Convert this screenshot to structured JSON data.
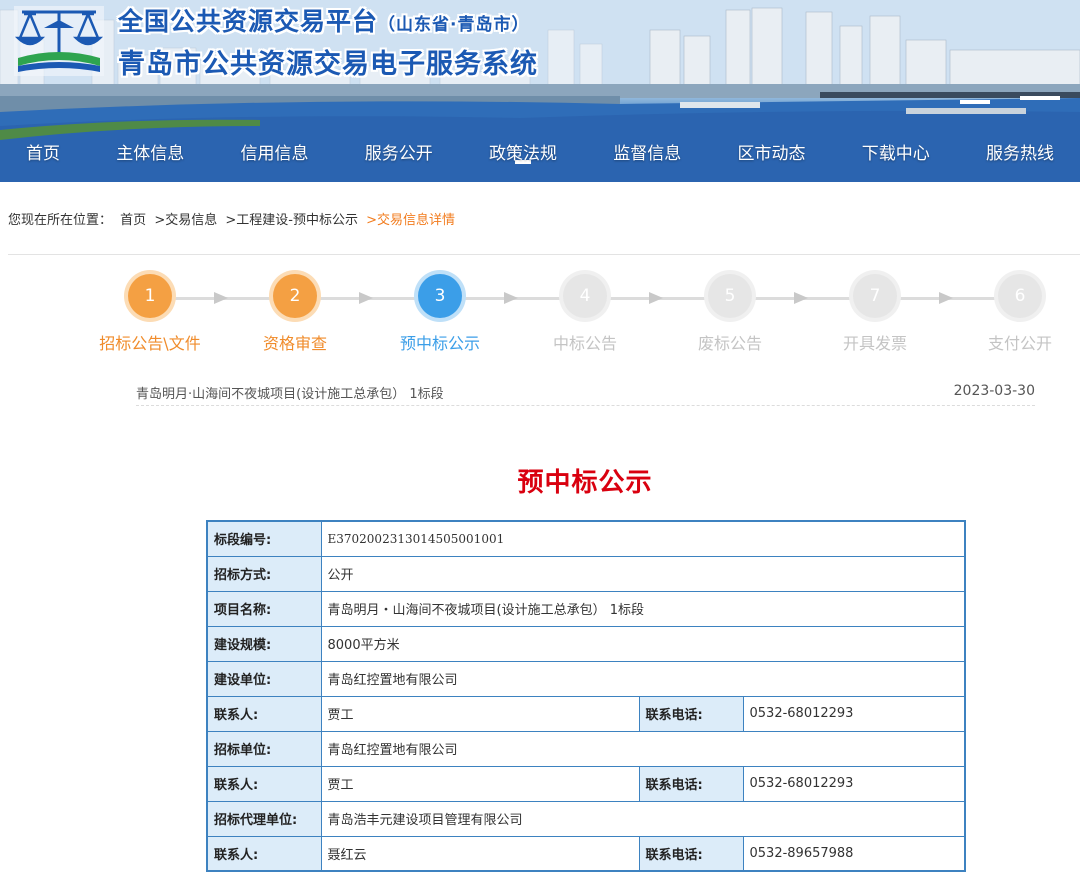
{
  "header": {
    "title_main": "全国公共资源交易平台",
    "title_region": "（山东省·青岛市）",
    "subtitle": "青岛市公共资源交易电子服务系统"
  },
  "nav": {
    "items": [
      "首页",
      "主体信息",
      "信用信息",
      "服务公开",
      "政策法规",
      "监督信息",
      "区市动态",
      "下载中心",
      "服务热线"
    ]
  },
  "breadcrumb": {
    "prefix": "您现在所在位置：",
    "items": [
      "首页",
      ">交易信息",
      ">工程建设-预中标公示",
      ">交易信息详情"
    ]
  },
  "steps": [
    {
      "number": "1",
      "label": "招标公告\\文件",
      "state": "done"
    },
    {
      "number": "2",
      "label": "资格审查",
      "state": "done"
    },
    {
      "number": "3",
      "label": "预中标公示",
      "state": "active"
    },
    {
      "number": "4",
      "label": "中标公告",
      "state": "todo"
    },
    {
      "number": "5",
      "label": "废标公告",
      "state": "todo"
    },
    {
      "number": "7",
      "label": "开具发票",
      "state": "todo"
    },
    {
      "number": "6",
      "label": "支付公开",
      "state": "todo"
    }
  ],
  "project": {
    "name": "青岛明月·山海间不夜城项目(设计施工总承包）   1标段",
    "date": "2023-03-30"
  },
  "notice": {
    "title": "预中标公示",
    "rows": {
      "section_code": {
        "label": "标段编号:",
        "value": "E3702002313014505001001"
      },
      "bid_method": {
        "label": "招标方式:",
        "value": "公开"
      },
      "project_name": {
        "label": "项目名称:",
        "value": "青岛明月・山海间不夜城项目(设计施工总承包）  1标段"
      },
      "scale": {
        "label": "建设规模:",
        "value": "8000平方米"
      },
      "builder": {
        "label": "建设单位:",
        "value": "青岛红控置地有限公司"
      },
      "builder_contact": {
        "label": "联系人:",
        "value": "贾工",
        "phone_label": "联系电话:",
        "phone": "0532-68012293"
      },
      "tenderer": {
        "label": "招标单位:",
        "value": "青岛红控置地有限公司"
      },
      "tenderer_contact": {
        "label": "联系人:",
        "value": "贾工",
        "phone_label": "联系电话:",
        "phone": "0532-68012293"
      },
      "agency": {
        "label": "招标代理单位:",
        "value": "青岛浩丰元建设项目管理有限公司"
      },
      "agency_contact": {
        "label": "联系人:",
        "value": "聂红云",
        "phone_label": "联系电话:",
        "phone": "0532-89657988"
      }
    }
  },
  "colors": {
    "nav_blue": "#2a66b6",
    "step_done": "#f4a043",
    "step_active": "#3b9ee8",
    "step_todo": "#e6e6e6",
    "title_red": "#d9000f",
    "table_border": "#3d82c0",
    "table_key_bg": "#dcecf9",
    "breadcrumb_current": "#f27c1e"
  }
}
